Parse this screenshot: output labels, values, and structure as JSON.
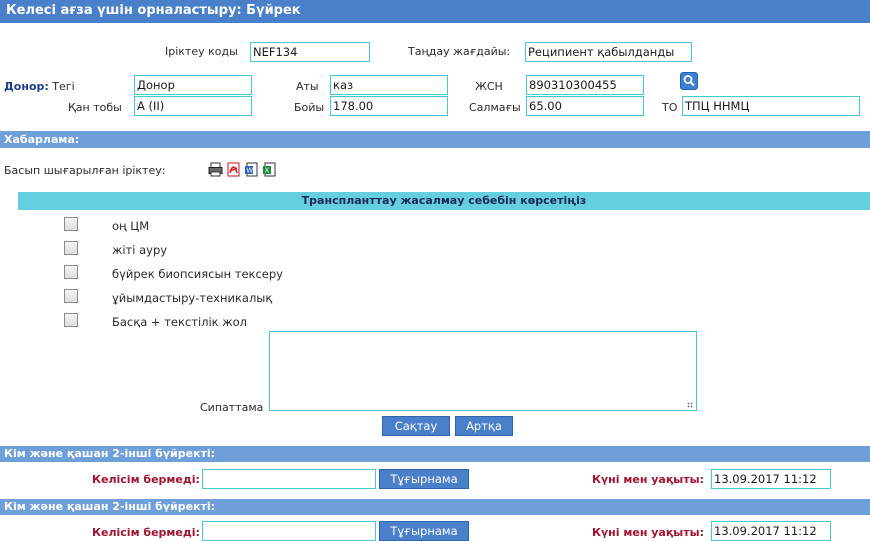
{
  "window": {
    "title": "Келесі ағза үшін орналастыру: Бүйрек"
  },
  "selection": {
    "code_label": "Іріктеу коды",
    "code_value": "NEF134",
    "status_label": "Таңдау жағдайы:",
    "status_value": "Реципиент қабылданды"
  },
  "donor": {
    "section_label": "Донор:",
    "surname_label": "Тегі",
    "surname_value": "Донор",
    "name_label": "Аты",
    "name_value": "каз",
    "iin_label": "ЖСН",
    "iin_value": "890310300455",
    "blood_label": "Қан тобы",
    "blood_value": "А (II)",
    "height_label": "Бойы",
    "height_value": "178.00",
    "weight_label": "Салмағы",
    "weight_value": "65.00",
    "to_label": "ТО",
    "to_value": "ТПЦ ННМЦ",
    "search_icon": "search-icon"
  },
  "message": {
    "header": "Хабарлама:",
    "print_label": "Басып шығарылған іріктеу:",
    "icons": [
      "printer-icon",
      "pdf-icon",
      "word-icon",
      "excel-icon"
    ]
  },
  "reasons": {
    "header": "Транспланттау жасалмау себебін көрсетіңіз",
    "items": [
      {
        "label": "оң ЦМ",
        "checked": false
      },
      {
        "label": "жіті ауру",
        "checked": false
      },
      {
        "label": "бүйрек биопсиясын тексеру",
        "checked": false
      },
      {
        "label": "ұйымдастыру-техникалық",
        "checked": false
      },
      {
        "label": "Басқа + текстілік жол",
        "checked": false
      }
    ],
    "description_label": "Сипаттама",
    "description_value": "",
    "save_button": "Сақтау",
    "back_button": "Артқа"
  },
  "second_kidney": [
    {
      "header": "Кім және қашан 2-інші бүйректі:",
      "refused_label": "Келісім бермеді:",
      "refused_value": "",
      "doc_button": "Тұғырнама",
      "datetime_label": "Күні мен уақыты:",
      "datetime_value": "13.09.2017 11:12"
    },
    {
      "header": "Кім және қашан 2-інші бүйректі:",
      "refused_label": "Келісім бермеді:",
      "refused_value": "",
      "doc_button": "Тұғырнама",
      "datetime_label": "Күні мен уақыты:",
      "datetime_value": "13.09.2017 11:12"
    }
  ],
  "colors": {
    "title_bar": "#4a7fca",
    "band": "#6f9fd8",
    "reason_header": "#66cfdf",
    "field_border": "#46c9d6",
    "accent_red": "#a0152f"
  }
}
